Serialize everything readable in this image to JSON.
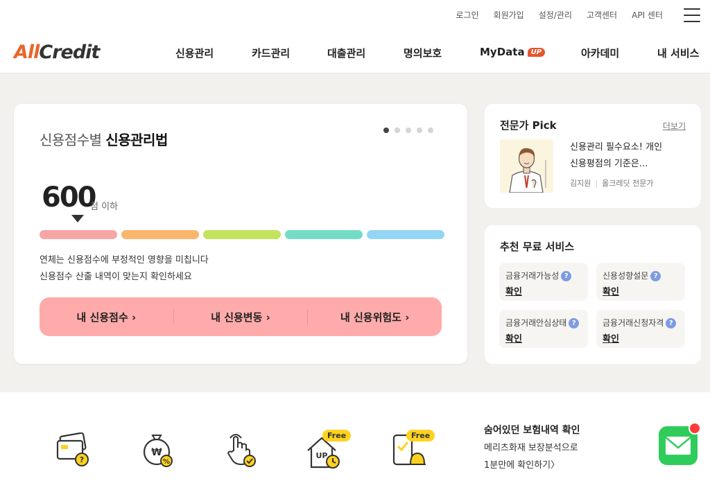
{
  "header": {
    "util_links": [
      "로그인",
      "회원가입",
      "설정/관리",
      "고객센터",
      "API 센터"
    ],
    "logo": {
      "part1": "All",
      "part2": "Credit"
    },
    "nav": [
      "신용관리",
      "카드관리",
      "대출관리",
      "명의보호",
      "MyData",
      "아카데미",
      "내 서비스"
    ],
    "mydata_badge": "UP"
  },
  "main_card": {
    "title_light": "신용점수별 ",
    "title_bold": "신용관리법",
    "slide_count": 5,
    "active_slide": 0,
    "score": "600",
    "score_unit": "점 이하",
    "scale_colors": [
      "#f7a5a5",
      "#fbb56c",
      "#c3e35d",
      "#72dcc7",
      "#93d6f3"
    ],
    "desc_lines": [
      "연체는 신용점수에 부정적인 영향을 미칩니다",
      "신용점수 산출 내역이 맞는지 확인하세요"
    ],
    "buttons": [
      "내 신용점수 ›",
      "내 신용변동 ›",
      "내 신용위험도 ›"
    ]
  },
  "pick_card": {
    "title": "전문가 Pick",
    "more": "더보기",
    "article_line1": "신용관리 필수요소! 개인",
    "article_line2": "신용평점의 기준은...",
    "author_name": "김지원",
    "author_role": "올크레딧 전문가"
  },
  "service_card": {
    "title": "추천 무료 서비스",
    "items": [
      {
        "label": "금융거래가능성",
        "action": "확인"
      },
      {
        "label": "신용성향설문",
        "action": "확인"
      },
      {
        "label": "금융거래안심상태",
        "action": "확인"
      },
      {
        "label": "금융거래신청자격",
        "action": "확인"
      }
    ]
  },
  "bottom": {
    "free_badge": "Free",
    "up_label": "UP",
    "promo_title": "숨어있던 보험내역 확인",
    "promo_line2": "메리츠화재 보장분석으로",
    "promo_line3": "1분만에 확인하기〉"
  },
  "colors": {
    "accent": "#e8662b",
    "pink_button": "#ffabab",
    "band": "#f2f1ee",
    "mail_green": "#2fcc5b"
  }
}
